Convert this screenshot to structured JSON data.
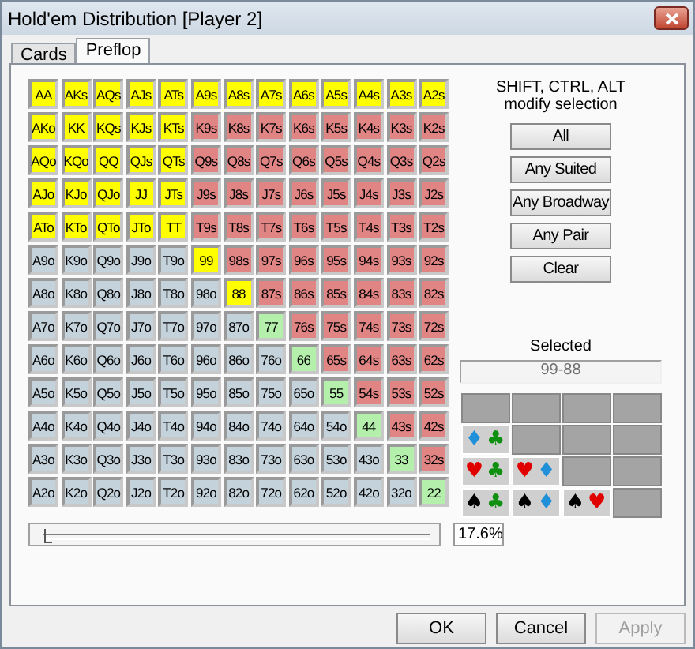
{
  "window": {
    "title": "Hold'em Distribution [Player 2]"
  },
  "tabs": [
    {
      "label": "Cards",
      "selected": false
    },
    {
      "label": "Preflop",
      "selected": true
    }
  ],
  "grid": {
    "rows": [
      [
        {
          "label": "AA",
          "selected": true
        },
        {
          "label": "AKs",
          "selected": true
        },
        {
          "label": "AQs",
          "selected": true
        },
        {
          "label": "AJs",
          "selected": true
        },
        {
          "label": "ATs",
          "selected": true
        },
        {
          "label": "A9s",
          "selected": true
        },
        {
          "label": "A8s",
          "selected": true
        },
        {
          "label": "A7s",
          "selected": true
        },
        {
          "label": "A6s",
          "selected": true
        },
        {
          "label": "A5s",
          "selected": true
        },
        {
          "label": "A4s",
          "selected": true
        },
        {
          "label": "A3s",
          "selected": true
        },
        {
          "label": "A2s",
          "selected": true
        }
      ],
      [
        {
          "label": "AKo",
          "selected": true
        },
        {
          "label": "KK",
          "selected": true
        },
        {
          "label": "KQs",
          "selected": true
        },
        {
          "label": "KJs",
          "selected": true
        },
        {
          "label": "KTs",
          "selected": true
        },
        {
          "label": "K9s",
          "kind": "suited",
          "selected": false
        },
        {
          "label": "K8s",
          "kind": "suited",
          "selected": false
        },
        {
          "label": "K7s",
          "kind": "suited",
          "selected": false
        },
        {
          "label": "K6s",
          "kind": "suited",
          "selected": false
        },
        {
          "label": "K5s",
          "kind": "suited",
          "selected": false
        },
        {
          "label": "K4s",
          "kind": "suited",
          "selected": false
        },
        {
          "label": "K3s",
          "kind": "suited",
          "selected": false
        },
        {
          "label": "K2s",
          "kind": "suited",
          "selected": false
        }
      ],
      [
        {
          "label": "AQo",
          "selected": true
        },
        {
          "label": "KQo",
          "selected": true
        },
        {
          "label": "QQ",
          "selected": true
        },
        {
          "label": "QJs",
          "selected": true
        },
        {
          "label": "QTs",
          "selected": true
        },
        {
          "label": "Q9s",
          "kind": "suited",
          "selected": false
        },
        {
          "label": "Q8s",
          "kind": "suited",
          "selected": false
        },
        {
          "label": "Q7s",
          "kind": "suited",
          "selected": false
        },
        {
          "label": "Q6s",
          "kind": "suited",
          "selected": false
        },
        {
          "label": "Q5s",
          "kind": "suited",
          "selected": false
        },
        {
          "label": "Q4s",
          "kind": "suited",
          "selected": false
        },
        {
          "label": "Q3s",
          "kind": "suited",
          "selected": false
        },
        {
          "label": "Q2s",
          "kind": "suited",
          "selected": false
        }
      ],
      [
        {
          "label": "AJo",
          "selected": true
        },
        {
          "label": "KJo",
          "selected": true
        },
        {
          "label": "QJo",
          "selected": true
        },
        {
          "label": "JJ",
          "selected": true
        },
        {
          "label": "JTs",
          "selected": true
        },
        {
          "label": "J9s",
          "kind": "suited",
          "selected": false
        },
        {
          "label": "J8s",
          "kind": "suited",
          "selected": false
        },
        {
          "label": "J7s",
          "kind": "suited",
          "selected": false
        },
        {
          "label": "J6s",
          "kind": "suited",
          "selected": false
        },
        {
          "label": "J5s",
          "kind": "suited",
          "selected": false
        },
        {
          "label": "J4s",
          "kind": "suited",
          "selected": false
        },
        {
          "label": "J3s",
          "kind": "suited",
          "selected": false
        },
        {
          "label": "J2s",
          "kind": "suited",
          "selected": false
        }
      ],
      [
        {
          "label": "ATo",
          "selected": true
        },
        {
          "label": "KTo",
          "selected": true
        },
        {
          "label": "QTo",
          "selected": true
        },
        {
          "label": "JTo",
          "selected": true
        },
        {
          "label": "TT",
          "selected": true
        },
        {
          "label": "T9s",
          "kind": "suited",
          "selected": false
        },
        {
          "label": "T8s",
          "kind": "suited",
          "selected": false
        },
        {
          "label": "T7s",
          "kind": "suited",
          "selected": false
        },
        {
          "label": "T6s",
          "kind": "suited",
          "selected": false
        },
        {
          "label": "T5s",
          "kind": "suited",
          "selected": false
        },
        {
          "label": "T4s",
          "kind": "suited",
          "selected": false
        },
        {
          "label": "T3s",
          "kind": "suited",
          "selected": false
        },
        {
          "label": "T2s",
          "kind": "suited",
          "selected": false
        }
      ],
      [
        {
          "label": "A9o",
          "kind": "offsuit",
          "selected": false
        },
        {
          "label": "K9o",
          "kind": "offsuit",
          "selected": false
        },
        {
          "label": "Q9o",
          "kind": "offsuit",
          "selected": false
        },
        {
          "label": "J9o",
          "kind": "offsuit",
          "selected": false
        },
        {
          "label": "T9o",
          "kind": "offsuit",
          "selected": false
        },
        {
          "label": "99",
          "selected": true
        },
        {
          "label": "98s",
          "kind": "suited",
          "selected": false
        },
        {
          "label": "97s",
          "kind": "suited",
          "selected": false
        },
        {
          "label": "96s",
          "kind": "suited",
          "selected": false
        },
        {
          "label": "95s",
          "kind": "suited",
          "selected": false
        },
        {
          "label": "94s",
          "kind": "suited",
          "selected": false
        },
        {
          "label": "93s",
          "kind": "suited",
          "selected": false
        },
        {
          "label": "92s",
          "kind": "suited",
          "selected": false
        }
      ],
      [
        {
          "label": "A8o",
          "kind": "offsuit",
          "selected": false
        },
        {
          "label": "K8o",
          "kind": "offsuit",
          "selected": false
        },
        {
          "label": "Q8o",
          "kind": "offsuit",
          "selected": false
        },
        {
          "label": "J8o",
          "kind": "offsuit",
          "selected": false
        },
        {
          "label": "T8o",
          "kind": "offsuit",
          "selected": false
        },
        {
          "label": "98o",
          "kind": "offsuit",
          "selected": false
        },
        {
          "label": "88",
          "selected": true
        },
        {
          "label": "87s",
          "kind": "suited",
          "selected": false
        },
        {
          "label": "86s",
          "kind": "suited",
          "selected": false
        },
        {
          "label": "85s",
          "kind": "suited",
          "selected": false
        },
        {
          "label": "84s",
          "kind": "suited",
          "selected": false
        },
        {
          "label": "83s",
          "kind": "suited",
          "selected": false
        },
        {
          "label": "82s",
          "kind": "suited",
          "selected": false
        }
      ],
      [
        {
          "label": "A7o",
          "kind": "offsuit",
          "selected": false
        },
        {
          "label": "K7o",
          "kind": "offsuit",
          "selected": false
        },
        {
          "label": "Q7o",
          "kind": "offsuit",
          "selected": false
        },
        {
          "label": "J7o",
          "kind": "offsuit",
          "selected": false
        },
        {
          "label": "T7o",
          "kind": "offsuit",
          "selected": false
        },
        {
          "label": "97o",
          "kind": "offsuit",
          "selected": false
        },
        {
          "label": "87o",
          "kind": "offsuit",
          "selected": false
        },
        {
          "label": "77",
          "kind": "pair",
          "selected": false
        },
        {
          "label": "76s",
          "kind": "suited",
          "selected": false
        },
        {
          "label": "75s",
          "kind": "suited",
          "selected": false
        },
        {
          "label": "74s",
          "kind": "suited",
          "selected": false
        },
        {
          "label": "73s",
          "kind": "suited",
          "selected": false
        },
        {
          "label": "72s",
          "kind": "suited",
          "selected": false
        }
      ],
      [
        {
          "label": "A6o",
          "kind": "offsuit",
          "selected": false
        },
        {
          "label": "K6o",
          "kind": "offsuit",
          "selected": false
        },
        {
          "label": "Q6o",
          "kind": "offsuit",
          "selected": false
        },
        {
          "label": "J6o",
          "kind": "offsuit",
          "selected": false
        },
        {
          "label": "T6o",
          "kind": "offsuit",
          "selected": false
        },
        {
          "label": "96o",
          "kind": "offsuit",
          "selected": false
        },
        {
          "label": "86o",
          "kind": "offsuit",
          "selected": false
        },
        {
          "label": "76o",
          "kind": "offsuit",
          "selected": false
        },
        {
          "label": "66",
          "kind": "pair",
          "selected": false
        },
        {
          "label": "65s",
          "kind": "suited",
          "selected": false
        },
        {
          "label": "64s",
          "kind": "suited",
          "selected": false
        },
        {
          "label": "63s",
          "kind": "suited",
          "selected": false
        },
        {
          "label": "62s",
          "kind": "suited",
          "selected": false
        }
      ],
      [
        {
          "label": "A5o",
          "kind": "offsuit",
          "selected": false
        },
        {
          "label": "K5o",
          "kind": "offsuit",
          "selected": false
        },
        {
          "label": "Q5o",
          "kind": "offsuit",
          "selected": false
        },
        {
          "label": "J5o",
          "kind": "offsuit",
          "selected": false
        },
        {
          "label": "T5o",
          "kind": "offsuit",
          "selected": false
        },
        {
          "label": "95o",
          "kind": "offsuit",
          "selected": false
        },
        {
          "label": "85o",
          "kind": "offsuit",
          "selected": false
        },
        {
          "label": "75o",
          "kind": "offsuit",
          "selected": false
        },
        {
          "label": "65o",
          "kind": "offsuit",
          "selected": false
        },
        {
          "label": "55",
          "kind": "pair",
          "selected": false
        },
        {
          "label": "54s",
          "kind": "suited",
          "selected": false
        },
        {
          "label": "53s",
          "kind": "suited",
          "selected": false
        },
        {
          "label": "52s",
          "kind": "suited",
          "selected": false
        }
      ],
      [
        {
          "label": "A4o",
          "kind": "offsuit",
          "selected": false
        },
        {
          "label": "K4o",
          "kind": "offsuit",
          "selected": false
        },
        {
          "label": "Q4o",
          "kind": "offsuit",
          "selected": false
        },
        {
          "label": "J4o",
          "kind": "offsuit",
          "selected": false
        },
        {
          "label": "T4o",
          "kind": "offsuit",
          "selected": false
        },
        {
          "label": "94o",
          "kind": "offsuit",
          "selected": false
        },
        {
          "label": "84o",
          "kind": "offsuit",
          "selected": false
        },
        {
          "label": "74o",
          "kind": "offsuit",
          "selected": false
        },
        {
          "label": "64o",
          "kind": "offsuit",
          "selected": false
        },
        {
          "label": "54o",
          "kind": "offsuit",
          "selected": false
        },
        {
          "label": "44",
          "kind": "pair",
          "selected": false
        },
        {
          "label": "43s",
          "kind": "suited",
          "selected": false
        },
        {
          "label": "42s",
          "kind": "suited",
          "selected": false
        }
      ],
      [
        {
          "label": "A3o",
          "kind": "offsuit",
          "selected": false
        },
        {
          "label": "K3o",
          "kind": "offsuit",
          "selected": false
        },
        {
          "label": "Q3o",
          "kind": "offsuit",
          "selected": false
        },
        {
          "label": "J3o",
          "kind": "offsuit",
          "selected": false
        },
        {
          "label": "T3o",
          "kind": "offsuit",
          "selected": false
        },
        {
          "label": "93o",
          "kind": "offsuit",
          "selected": false
        },
        {
          "label": "83o",
          "kind": "offsuit",
          "selected": false
        },
        {
          "label": "73o",
          "kind": "offsuit",
          "selected": false
        },
        {
          "label": "63o",
          "kind": "offsuit",
          "selected": false
        },
        {
          "label": "53o",
          "kind": "offsuit",
          "selected": false
        },
        {
          "label": "43o",
          "kind": "offsuit",
          "selected": false
        },
        {
          "label": "33",
          "kind": "pair",
          "selected": false
        },
        {
          "label": "32s",
          "kind": "suited",
          "selected": false
        }
      ],
      [
        {
          "label": "A2o",
          "kind": "offsuit",
          "selected": false
        },
        {
          "label": "K2o",
          "kind": "offsuit",
          "selected": false
        },
        {
          "label": "Q2o",
          "kind": "offsuit",
          "selected": false
        },
        {
          "label": "J2o",
          "kind": "offsuit",
          "selected": false
        },
        {
          "label": "T2o",
          "kind": "offsuit",
          "selected": false
        },
        {
          "label": "92o",
          "kind": "offsuit",
          "selected": false
        },
        {
          "label": "82o",
          "kind": "offsuit",
          "selected": false
        },
        {
          "label": "72o",
          "kind": "offsuit",
          "selected": false
        },
        {
          "label": "62o",
          "kind": "offsuit",
          "selected": false
        },
        {
          "label": "52o",
          "kind": "offsuit",
          "selected": false
        },
        {
          "label": "42o",
          "kind": "offsuit",
          "selected": false
        },
        {
          "label": "32o",
          "kind": "offsuit",
          "selected": false
        },
        {
          "label": "22",
          "kind": "pair",
          "selected": false
        }
      ]
    ]
  },
  "slider": {
    "level": 0.02
  },
  "percent": "17.6%",
  "hint": [
    "SHIFT, CTRL, ALT",
    "modify selection"
  ],
  "quick_buttons": [
    "All",
    "Any Suited",
    "Any Broadway",
    "Any Pair",
    "Clear"
  ],
  "selected_label": "Selected",
  "selected_value": "99-88",
  "combos": [
    [
      {
        "kind": "empty"
      },
      {
        "kind": "empty"
      },
      {
        "kind": "empty"
      },
      {
        "kind": "empty"
      }
    ],
    [
      {
        "kind": "combo",
        "cards": [
          {
            "symbol": "♦",
            "color": "#2090d8"
          },
          {
            "symbol": "♣",
            "color": "#109010"
          }
        ]
      },
      {
        "kind": "empty"
      },
      {
        "kind": "empty"
      },
      {
        "kind": "empty"
      }
    ],
    [
      {
        "kind": "combo",
        "cards": [
          {
            "symbol": "♥",
            "color": "#e00000"
          },
          {
            "symbol": "♣",
            "color": "#109010"
          }
        ]
      },
      {
        "kind": "combo",
        "cards": [
          {
            "symbol": "♥",
            "color": "#e00000"
          },
          {
            "symbol": "♦",
            "color": "#2090d8"
          }
        ]
      },
      {
        "kind": "empty"
      },
      {
        "kind": "empty"
      }
    ],
    [
      {
        "kind": "combo",
        "cards": [
          {
            "symbol": "♠",
            "color": "#000000"
          },
          {
            "symbol": "♣",
            "color": "#109010"
          }
        ]
      },
      {
        "kind": "combo",
        "cards": [
          {
            "symbol": "♠",
            "color": "#000000"
          },
          {
            "symbol": "♦",
            "color": "#2090d8"
          }
        ]
      },
      {
        "kind": "combo",
        "cards": [
          {
            "symbol": "♠",
            "color": "#000000"
          },
          {
            "symbol": "♥",
            "color": "#e00000"
          }
        ]
      },
      {
        "kind": "empty"
      }
    ]
  ],
  "buttons": [
    {
      "label": "OK",
      "disabled": false
    },
    {
      "label": "Cancel",
      "disabled": false
    },
    {
      "label": "Apply",
      "disabled": true
    }
  ]
}
